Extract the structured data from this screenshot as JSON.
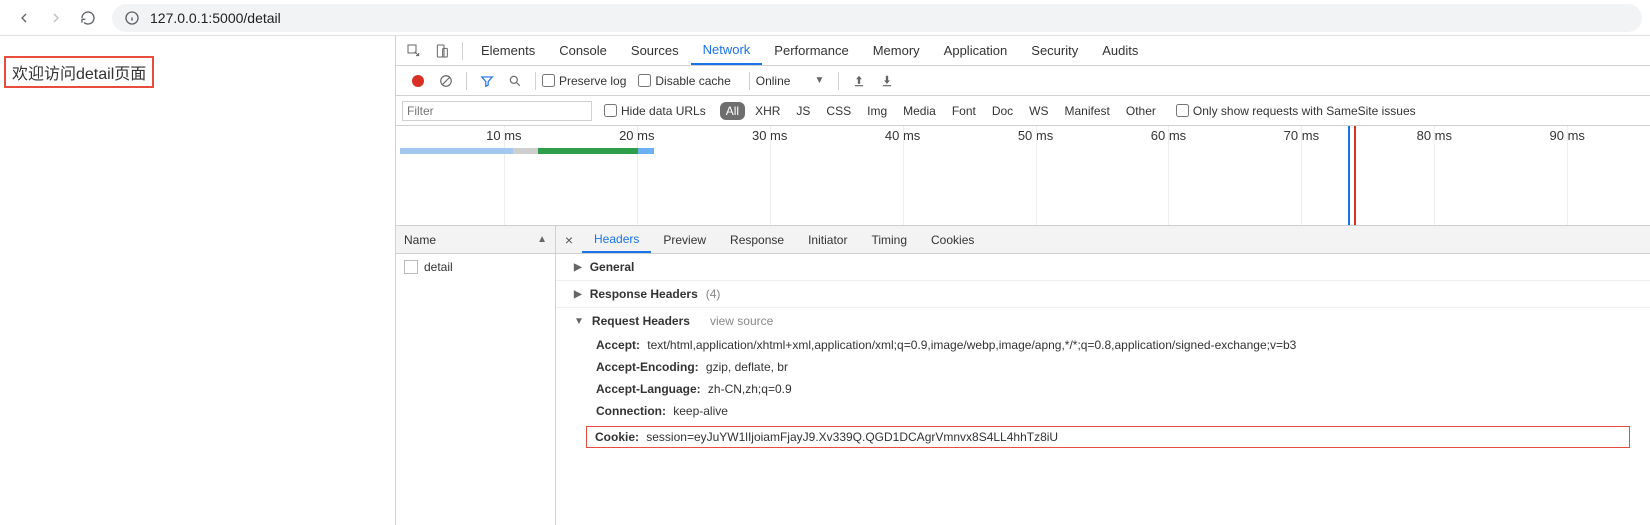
{
  "browser": {
    "url": "127.0.0.1:5000/detail"
  },
  "page": {
    "welcome": "欢迎访问detail页面"
  },
  "devtools": {
    "tabs": [
      "Elements",
      "Console",
      "Sources",
      "Network",
      "Performance",
      "Memory",
      "Application",
      "Security",
      "Audits"
    ],
    "activeTab": "Network"
  },
  "network": {
    "toolbar": {
      "preserve_log": "Preserve log",
      "disable_cache": "Disable cache",
      "throttle": "Online"
    },
    "filter": {
      "placeholder": "Filter",
      "hide_data_urls": "Hide data URLs",
      "types": [
        "All",
        "XHR",
        "JS",
        "CSS",
        "Img",
        "Media",
        "Font",
        "Doc",
        "WS",
        "Manifest",
        "Other"
      ],
      "samesite": "Only show requests with SameSite issues"
    },
    "timeline_ticks": [
      "10 ms",
      "20 ms",
      "30 ms",
      "40 ms",
      "50 ms",
      "60 ms",
      "70 ms",
      "80 ms",
      "90 ms"
    ],
    "requests": {
      "header": "Name",
      "items": [
        "detail"
      ]
    },
    "detail_tabs": [
      "Headers",
      "Preview",
      "Response",
      "Initiator",
      "Timing",
      "Cookies"
    ],
    "headers": {
      "general": "General",
      "response_headers": "Response Headers",
      "response_headers_count": "(4)",
      "request_headers": "Request Headers",
      "view_source": "view source",
      "items": [
        {
          "k": "Accept:",
          "v": "text/html,application/xhtml+xml,application/xml;q=0.9,image/webp,image/apng,*/*;q=0.8,application/signed-exchange;v=b3"
        },
        {
          "k": "Accept-Encoding:",
          "v": "gzip, deflate, br"
        },
        {
          "k": "Accept-Language:",
          "v": "zh-CN,zh;q=0.9"
        },
        {
          "k": "Connection:",
          "v": "keep-alive"
        },
        {
          "k": "Cookie:",
          "v": "session=eyJuYW1lIjoiamFjayJ9.Xv339Q.QGD1DCAgrVmnvx8S4LL4hhTz8iU"
        }
      ]
    }
  }
}
